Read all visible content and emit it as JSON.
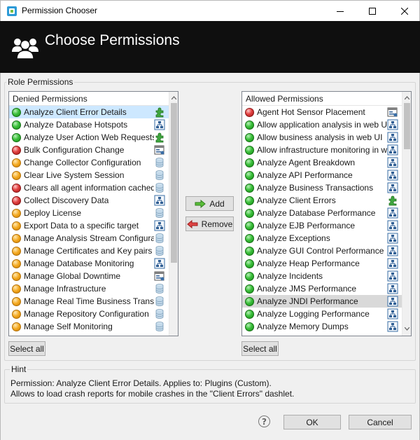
{
  "window": {
    "title": "Permission Chooser",
    "controls": [
      "minimize",
      "maximize",
      "close"
    ]
  },
  "header": {
    "title": "Choose Permissions",
    "icon": "users-icon"
  },
  "role_permissions": {
    "label": "Role Permissions",
    "denied": {
      "header": "Denied Permissions",
      "items": [
        {
          "label": "Analyze Client Error Details",
          "status": "green",
          "icon": "plugin-icon",
          "selected": true
        },
        {
          "label": "Analyze Database Hotspots",
          "status": "green",
          "icon": "network-icon"
        },
        {
          "label": "Analyze User Action Web Requests",
          "status": "green",
          "icon": "plugin-icon"
        },
        {
          "label": "Bulk Configuration Change",
          "status": "red",
          "icon": "config-window-icon"
        },
        {
          "label": "Change Collector Configuration",
          "status": "orange",
          "icon": "database-icon"
        },
        {
          "label": "Clear Live System Session",
          "status": "orange",
          "icon": "database-icon"
        },
        {
          "label": "Clears all agent information cached ...",
          "status": "red",
          "icon": "database-icon"
        },
        {
          "label": "Collect Discovery Data",
          "status": "red",
          "icon": "network-icon"
        },
        {
          "label": "Deploy License",
          "status": "orange",
          "icon": "database-icon"
        },
        {
          "label": "Export Data to a specific target",
          "status": "orange",
          "icon": "network-icon"
        },
        {
          "label": "Manage Analysis Stream Configurati...",
          "status": "orange",
          "icon": "database-icon"
        },
        {
          "label": "Manage Certificates and Key pairs u...",
          "status": "orange",
          "icon": "database-icon"
        },
        {
          "label": "Manage Database Monitoring",
          "status": "orange",
          "icon": "network-icon"
        },
        {
          "label": "Manage Global Downtime",
          "status": "orange",
          "icon": "config-window-icon"
        },
        {
          "label": "Manage Infrastructure",
          "status": "orange",
          "icon": "database-icon"
        },
        {
          "label": "Manage Real Time Business Transac...",
          "status": "orange",
          "icon": "database-icon"
        },
        {
          "label": "Manage Repository Configuration",
          "status": "orange",
          "icon": "database-icon"
        },
        {
          "label": "Manage Self Monitoring",
          "status": "orange",
          "icon": "database-icon"
        }
      ],
      "select_all": "Select all"
    },
    "allowed": {
      "header": "Allowed Permissions",
      "items": [
        {
          "label": "Agent Hot Sensor Placement",
          "status": "red",
          "icon": "config-window-icon"
        },
        {
          "label": "Allow application analysis in web UI",
          "status": "green",
          "icon": "network-icon"
        },
        {
          "label": "Allow business analysis in web UI",
          "status": "green",
          "icon": "network-icon"
        },
        {
          "label": "Allow infrastructure monitoring in w...",
          "status": "green",
          "icon": "network-icon"
        },
        {
          "label": "Analyze Agent Breakdown",
          "status": "green",
          "icon": "network-icon"
        },
        {
          "label": "Analyze API Performance",
          "status": "green",
          "icon": "network-icon"
        },
        {
          "label": "Analyze Business Transactions",
          "status": "green",
          "icon": "network-icon"
        },
        {
          "label": "Analyze Client Errors",
          "status": "green",
          "icon": "plugin-icon"
        },
        {
          "label": "Analyze Database Performance",
          "status": "green",
          "icon": "network-icon"
        },
        {
          "label": "Analyze EJB Performance",
          "status": "green",
          "icon": "network-icon"
        },
        {
          "label": "Analyze Exceptions",
          "status": "green",
          "icon": "network-icon"
        },
        {
          "label": "Analyze GUI Control Performance",
          "status": "green",
          "icon": "network-icon"
        },
        {
          "label": "Analyze Heap Performance",
          "status": "green",
          "icon": "network-icon"
        },
        {
          "label": "Analyze Incidents",
          "status": "green",
          "icon": "network-icon"
        },
        {
          "label": "Analyze JMS Performance",
          "status": "green",
          "icon": "network-icon"
        },
        {
          "label": "Analyze JNDI Performance",
          "status": "green",
          "icon": "network-icon",
          "highlighted": true
        },
        {
          "label": "Analyze Logging Performance",
          "status": "green",
          "icon": "network-icon"
        },
        {
          "label": "Analyze Memory Dumps",
          "status": "green",
          "icon": "network-icon"
        }
      ],
      "select_all": "Select all"
    },
    "add_label": "Add",
    "remove_label": "Remove"
  },
  "hint": {
    "label": "Hint",
    "line1": "Permission: Analyze Client Error Details. Applies to: Plugins (Custom).",
    "line2": "Allows to load crash reports for mobile crashes in the \"Client Errors\" dashlet."
  },
  "footer": {
    "help": "?",
    "ok": "OK",
    "cancel": "Cancel"
  },
  "colors": {
    "header_bg": "#0f0f0f",
    "selection": "#cde8ff",
    "highlight_gray": "#d9d9d9",
    "status_green": "#3cc03c",
    "status_red": "#e24040",
    "status_orange": "#f4a81e"
  }
}
